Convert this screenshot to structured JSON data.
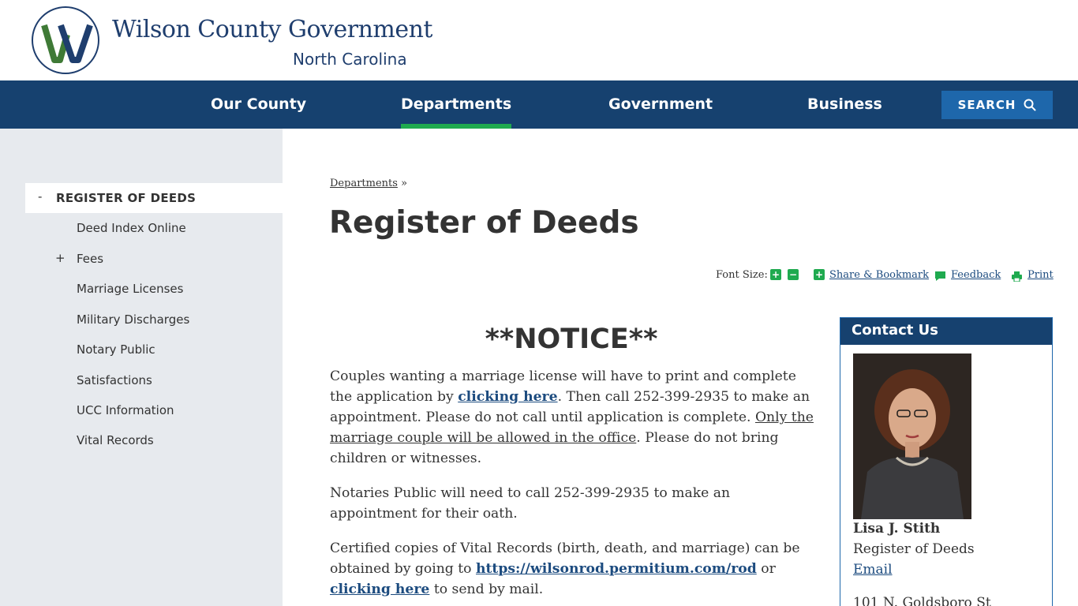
{
  "header": {
    "logo_letter": "W",
    "title": "Wilson County Government",
    "subtitle": "North Carolina"
  },
  "nav": {
    "items": [
      "Our County",
      "Departments",
      "Government",
      "Business"
    ],
    "active": "Departments",
    "search_label": "SEARCH"
  },
  "sidebar": {
    "active_toggle": "-",
    "active_item": "REGISTER OF DEEDS",
    "expand_toggle": "+",
    "items": [
      "Deed Index Online",
      "Fees",
      "Marriage Licenses",
      "Military Discharges",
      "Notary Public",
      "Satisfactions",
      "UCC Information",
      "Vital Records"
    ]
  },
  "breadcrumb": {
    "link": "Departments",
    "separator": "»"
  },
  "page_title": "Register of Deeds",
  "tools": {
    "font_size_label": "Font Size:",
    "increase": "+",
    "decrease": "−",
    "share_icon_glyph": "+",
    "share": "Share & Bookmark",
    "feedback": "Feedback",
    "print": "Print"
  },
  "notice": {
    "title": "**NOTICE**",
    "p1": {
      "before_link": "Couples wanting a marriage license will have to print and complete the application by ",
      "link": "clicking here",
      "after_link": ". Then call 252-399-2935 to make an appointment.  Please do not call until application is complete. ",
      "underlined": "Only the marriage couple will be allowed in the office",
      "end": ".  Please do not bring children or witnesses."
    },
    "p2": " Notaries Public will need to call 252-399-2935 to make an appointment for their oath.",
    "p3": {
      "before_link": " Certified copies of Vital Records (birth, death, and marriage) can be obtained by going to ",
      "link1": "https://wilsonrod.permitium.com/rod",
      "between": " or ",
      "link2": "clicking here",
      "end": " to send by mail."
    }
  },
  "contact": {
    "heading": "Contact Us",
    "name": "Lisa J. Stith",
    "role": "Register of Deeds",
    "email_label": "Email",
    "address": "101 N. Goldsboro St"
  },
  "colors": {
    "navy": "#16416f",
    "accent_green": "#1faa4f",
    "search_blue": "#1e67ab",
    "sidebar_bg": "#e7eaee",
    "link": "#1c4b7f"
  }
}
